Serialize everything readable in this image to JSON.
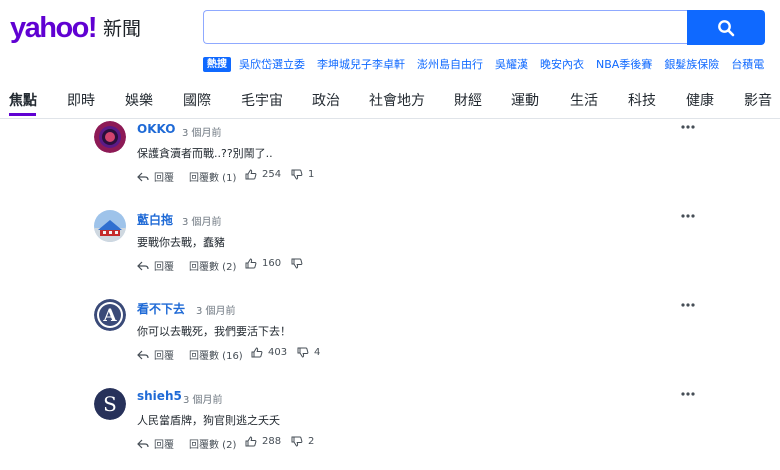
{
  "header": {
    "logo": "yahoo!",
    "logo_sub": "新聞",
    "search": {
      "value": "",
      "placeholder": ""
    },
    "hot_badge": "熱搜",
    "trending": [
      "吳欣岱選立委",
      "李坤城兒子李卓軒",
      "澎州島自由行",
      "吳耀漢",
      "晚安內衣",
      "NBA季後賽",
      "銀髮族保險",
      "台積電"
    ]
  },
  "nav": {
    "items": [
      "焦點",
      "即時",
      "娛樂",
      "國際",
      "毛宇宙",
      "政治",
      "社會地方",
      "財經",
      "運動",
      "生活",
      "科技",
      "健康",
      "影音"
    ],
    "active": "焦點"
  },
  "actions": {
    "reply": "回覆"
  },
  "comments": [
    {
      "user": "OKKO",
      "time": "3 個月前",
      "text": "保護貪瀆者而戰..??別鬧了..",
      "replies_label": "回覆數 (1)",
      "likes": "254",
      "dislikes": "1",
      "avatar": {
        "type": "ring",
        "colors": [
          "#8d1a56",
          "#5a1a86"
        ]
      }
    },
    {
      "user": "藍白拖",
      "time": "3 個月前",
      "text": "要戰你去戰，蠢豬",
      "replies_label": "回覆數 (2)",
      "likes": "160",
      "dislikes": "",
      "avatar": {
        "type": "photo",
        "colors": [
          "#2f6fd0",
          "#c42b2b"
        ]
      }
    },
    {
      "user": "看不下去",
      "time": "3 個月前",
      "text": "你可以去戰死，我們要活下去！",
      "replies_label": "回覆數 (16)",
      "likes": "403",
      "dislikes": "4",
      "avatar": {
        "type": "letter",
        "letter": "A",
        "colors": [
          "#3a4a78",
          "#ffffff"
        ]
      }
    },
    {
      "user": "shieh5",
      "time": "3 個月前",
      "text": "人民當盾牌，狗官則逃之夭夭",
      "replies_label": "回覆數 (2)",
      "likes": "288",
      "dislikes": "2",
      "avatar": {
        "type": "letter",
        "letter": "S",
        "colors": [
          "#27315a",
          "#ffffff"
        ]
      }
    }
  ],
  "colors": {
    "brand": "#6001d2",
    "link": "#0f69ff",
    "username": "#1f6ad6"
  }
}
